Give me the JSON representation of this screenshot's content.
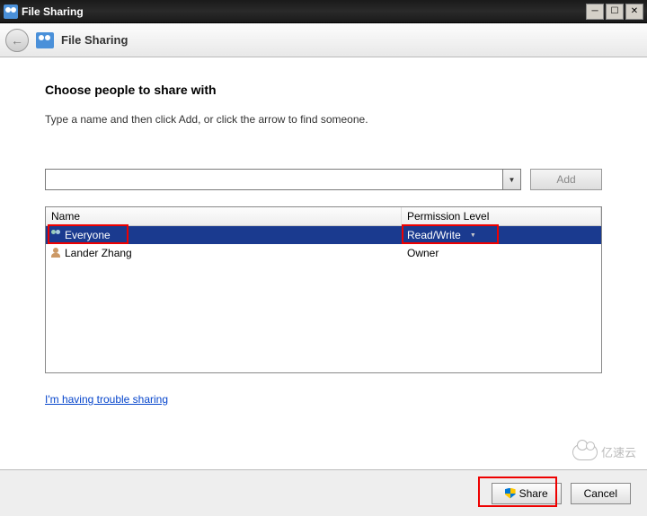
{
  "window": {
    "title": "File Sharing"
  },
  "header": {
    "title": "File Sharing"
  },
  "main": {
    "heading": "Choose people to share with",
    "subtext": "Type a name and then click Add, or click the arrow to find someone.",
    "name_input": "",
    "add_label": "Add",
    "columns": {
      "name": "Name",
      "permission": "Permission Level"
    },
    "rows": [
      {
        "name": "Everyone",
        "permission": "Read/Write",
        "icon": "group",
        "selected": true,
        "has_dropdown": true
      },
      {
        "name": "Lander Zhang",
        "permission": "Owner",
        "icon": "single",
        "selected": false,
        "has_dropdown": false
      }
    ],
    "trouble_link": "I'm having trouble sharing"
  },
  "footer": {
    "share_label": "Share",
    "cancel_label": "Cancel"
  },
  "watermark": "亿速云"
}
